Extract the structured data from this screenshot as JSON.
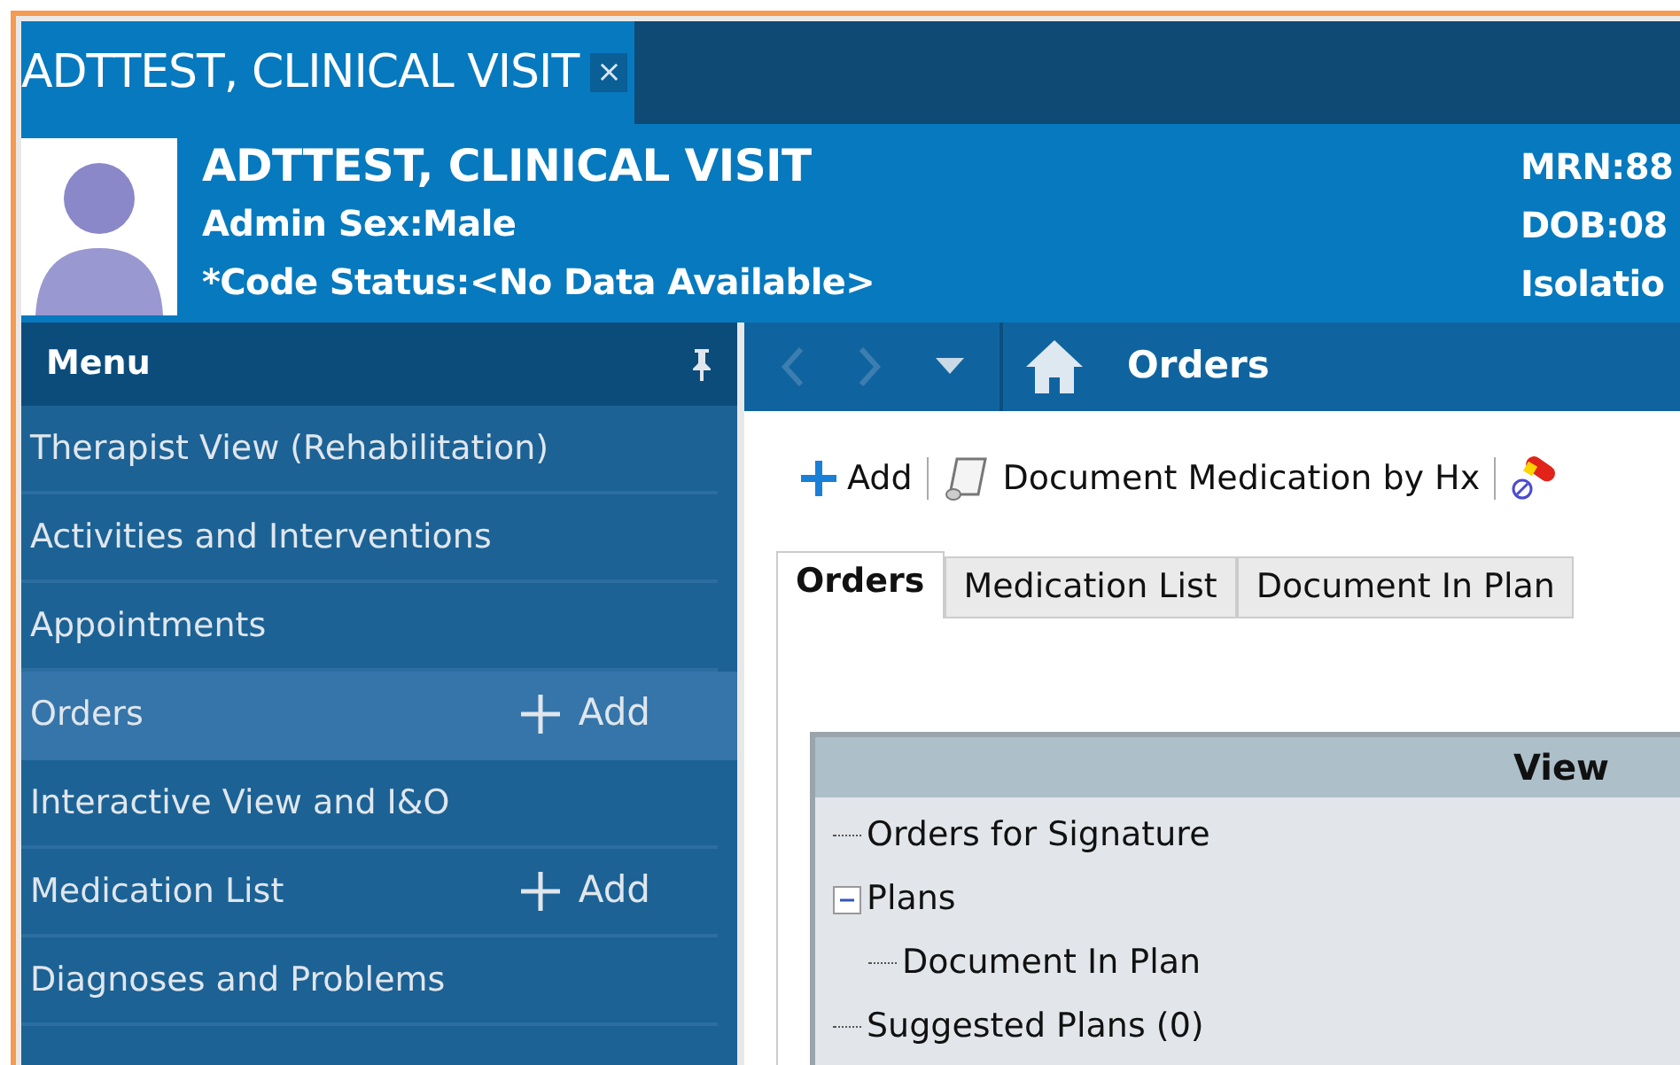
{
  "patient_tab": {
    "title": "ADTTEST, CLINICAL VISIT",
    "close": "×"
  },
  "banner": {
    "name": "ADTTEST, CLINICAL VISIT",
    "lines": [
      "Admin Sex:Male",
      "*Code Status:<No Data Available>"
    ],
    "right_lines": [
      "MRN:88",
      "DOB:08",
      "Isolatio"
    ]
  },
  "menu": {
    "title": "Menu",
    "items": [
      {
        "label": "Therapist View (Rehabilitation)",
        "selected": false
      },
      {
        "label": "Activities and Interventions",
        "selected": false
      },
      {
        "label": "Appointments",
        "selected": false
      },
      {
        "label": "Orders",
        "selected": true,
        "add": "Add"
      },
      {
        "label": "Interactive View and I&O",
        "selected": false
      },
      {
        "label": "Medication List",
        "selected": false,
        "add": "Add"
      },
      {
        "label": "Diagnoses and Problems",
        "selected": false
      }
    ]
  },
  "page_title": "Orders",
  "toolbar": [
    {
      "kind": "add",
      "label": "Add"
    },
    {
      "kind": "scroll",
      "label": "Document Medication by Hx"
    },
    {
      "kind": "pill"
    }
  ],
  "tabs": [
    {
      "label": "Orders",
      "selected": true
    },
    {
      "label": "Medication List",
      "selected": false
    },
    {
      "label": "Document In Plan",
      "selected": false
    }
  ],
  "tree": {
    "header": "View",
    "items": [
      {
        "label": "Orders for Signature"
      },
      {
        "label": "Plans",
        "expanded": true,
        "children": [
          {
            "label": "Document In Plan"
          }
        ]
      },
      {
        "label": "Suggested Plans (0)"
      }
    ]
  }
}
